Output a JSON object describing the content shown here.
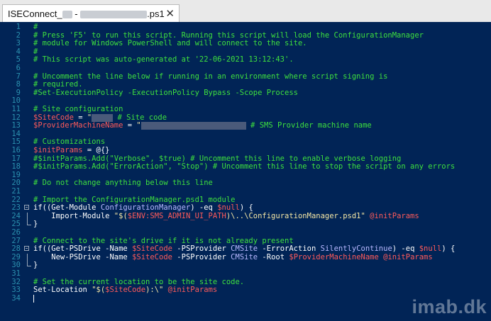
{
  "tab": {
    "name_start": "ISEConnect_",
    "name_mid": " - ",
    "name_end": ".ps1",
    "close": "✕"
  },
  "lines": [
    "1",
    "2",
    "3",
    "4",
    "5",
    "6",
    "7",
    "8",
    "9",
    "10",
    "11",
    "12",
    "13",
    "14",
    "15",
    "16",
    "17",
    "18",
    "19",
    "20",
    "21",
    "22",
    "23",
    "24",
    "25",
    "26",
    "27",
    "28",
    "29",
    "30",
    "31",
    "32",
    "33",
    "34"
  ],
  "code": {
    "l1": "#",
    "l2": "# Press 'F5' to run this script. Running this script will load the ConfigurationManager",
    "l3": "# module for Windows PowerShell and will connect to the site.",
    "l4": "#",
    "l5": "# This script was auto-generated at '22-06-2021 13:12:43'.",
    "l7": "# Uncomment the line below if running in an environment where script signing is",
    "l8": "# required.",
    "l9": "#Set-ExecutionPolicy -ExecutionPolicy Bypass -Scope Process",
    "l11": "# Site configuration",
    "l12_var": "$SiteCode",
    "l12_eq": " = ",
    "l12_q": "\"",
    "l12_cm": " # Site code",
    "l13_var": "$ProviderMachineName",
    "l13_eq": " = ",
    "l13_q": "\"",
    "l13_cm": " # SMS Provider machine name",
    "l15": "# Customizations",
    "l16_var": "$initParams",
    "l16_rest": " = @{}",
    "l17": "#$initParams.Add(\"Verbose\", $true) # Uncomment this line to enable verbose logging",
    "l18": "#$initParams.Add(\"ErrorAction\", \"Stop\") # Uncomment this line to stop the script on any errors",
    "l20": "# Do not change anything below this line",
    "l22": "# Import the ConfigurationManager.psd1 module",
    "l23_a": "if((Get-Module ",
    "l23_b": "ConfigurationManager",
    "l23_c": ") -eq ",
    "l23_d": "$null",
    "l23_e": ") {",
    "l24_a": "    Import-Module ",
    "l24_b": "\"$(",
    "l24_c": "$ENV:SMS_ADMIN_UI_PATH",
    "l24_d": ")\\..\\ConfigurationManager.psd1\"",
    "l24_e": " @initParams",
    "l25": "}",
    "l27": "# Connect to the site's drive if it is not already present",
    "l28_a": "if((Get-PSDrive -Name ",
    "l28_b": "$SiteCode",
    "l28_c": " -PSProvider ",
    "l28_d": "CMSite",
    "l28_e": " -ErrorAction ",
    "l28_f": "SilentlyContinue",
    "l28_g": ") -eq ",
    "l28_h": "$null",
    "l28_i": ") {",
    "l29_a": "    New-PSDrive -Name ",
    "l29_b": "$SiteCode",
    "l29_c": " -PSProvider ",
    "l29_d": "CMSite",
    "l29_e": " -Root ",
    "l29_f": "$ProviderMachineName",
    "l29_g": " @initParams",
    "l30": "}",
    "l32": "# Set the current location to be the site code.",
    "l33_a": "Set-Location ",
    "l33_b": "\"$(",
    "l33_c": "$SiteCode",
    "l33_d": "):\\\"",
    "l33_e": " @initParams"
  },
  "watermark": "imab.dk",
  "colors": {
    "background": "#012456",
    "comment": "#3ee03e",
    "variable": "#ff5a5a",
    "string": "#f5e7a5",
    "line_number": "#2b91af"
  }
}
